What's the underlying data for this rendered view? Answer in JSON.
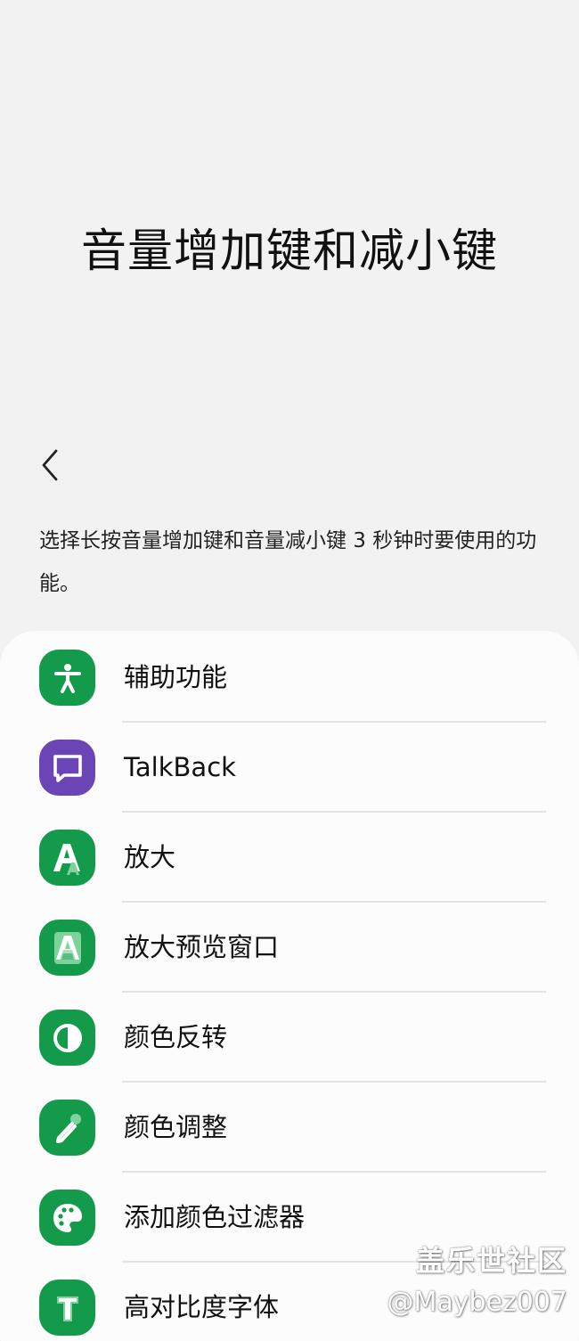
{
  "header": {
    "title": "音量增加键和减小键"
  },
  "description": "选择长按音量增加键和音量减小键 3 秒钟时要使用的功能。",
  "items": [
    {
      "label": "辅助功能",
      "icon": "accessibility-icon",
      "color": "#139a4b"
    },
    {
      "label": "TalkBack",
      "icon": "talkback-icon",
      "color": "#6b45b6"
    },
    {
      "label": "放大",
      "icon": "magnification-icon",
      "color": "#139a4b"
    },
    {
      "label": "放大预览窗口",
      "icon": "magnifier-window-icon",
      "color": "#139a4b"
    },
    {
      "label": "颜色反转",
      "icon": "color-inversion-icon",
      "color": "#139a4b"
    },
    {
      "label": "颜色调整",
      "icon": "color-adjustment-icon",
      "color": "#139a4b"
    },
    {
      "label": "添加颜色过滤器",
      "icon": "color-filter-icon",
      "color": "#139a4b"
    },
    {
      "label": "高对比度字体",
      "icon": "high-contrast-font-icon",
      "color": "#139a4b"
    }
  ],
  "watermark": {
    "brand": "盖乐世社区",
    "user": "@Maybez007"
  }
}
